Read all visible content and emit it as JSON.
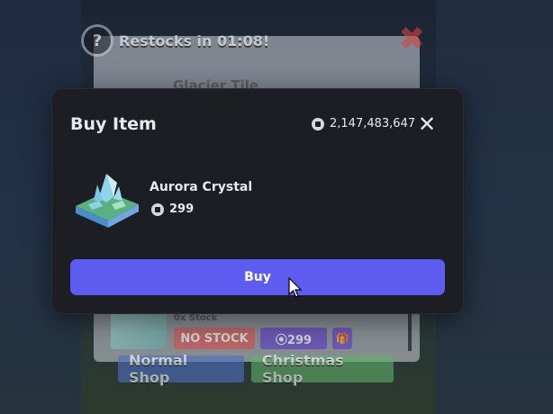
{
  "background": {
    "restock_label": "Restocks in 01:08!",
    "help_icon": "question-mark-icon",
    "close_icon": "red-x-icon",
    "shop_item_name": "Glacier Tile",
    "stock_text": "0x Stock",
    "no_stock_label": "NO STOCK",
    "price_label": "⦿299",
    "gift_icon": "gift-icon",
    "tabs": [
      {
        "label": "Normal Shop"
      },
      {
        "label": "Christmas Shop"
      }
    ]
  },
  "dialog": {
    "title": "Buy Item",
    "balance": "2,147,483,647",
    "currency_icon": "robux-icon",
    "close_icon": "close-icon",
    "item": {
      "name": "Aurora Crystal",
      "price": "299"
    },
    "buy_label": "Buy"
  },
  "colors": {
    "dialog_bg": "#1d1e23",
    "buy_button": "#5d5cf0",
    "text": "#e8e9ec"
  }
}
